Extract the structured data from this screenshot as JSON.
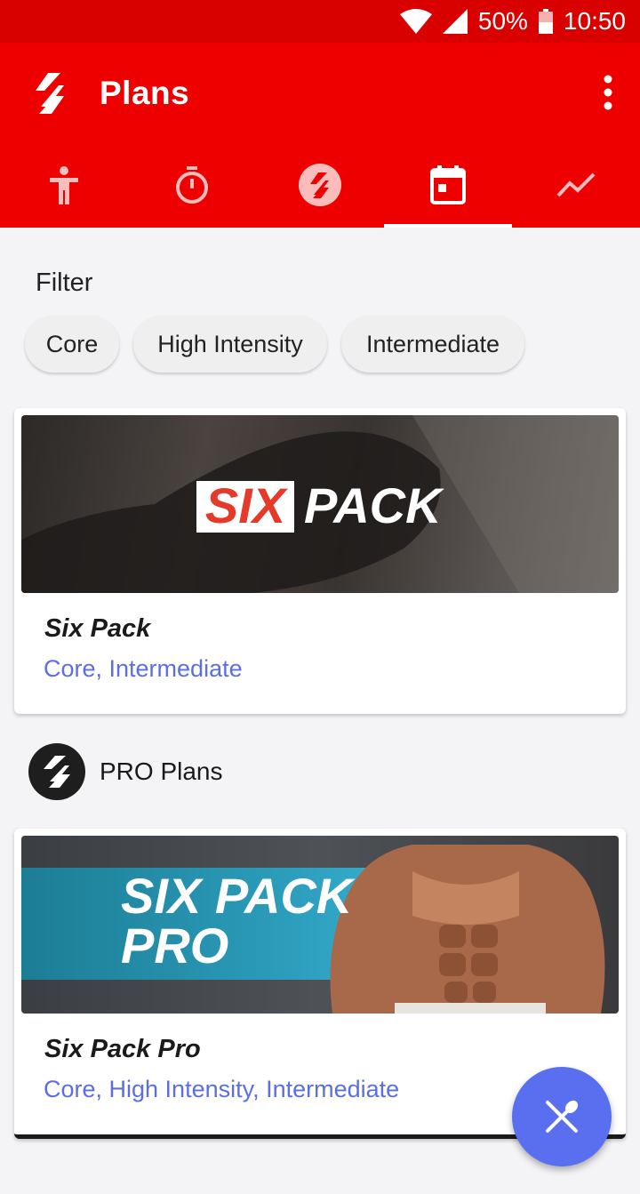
{
  "status_bar": {
    "battery": "50%",
    "time": "10:50"
  },
  "app_bar": {
    "title": "Plans",
    "more_icon": "more-vert-icon"
  },
  "tabs": [
    {
      "icon": "person-icon",
      "selected": false
    },
    {
      "icon": "stopwatch-icon",
      "selected": false
    },
    {
      "icon": "freeletics-logo-icon",
      "selected": false
    },
    {
      "icon": "calendar-icon",
      "selected": true
    },
    {
      "icon": "trend-chart-icon",
      "selected": false
    }
  ],
  "filter": {
    "title": "Filter",
    "chips": [
      "Core",
      "High Intensity",
      "Intermediate"
    ]
  },
  "plans": [
    {
      "banner": {
        "word1": "SIX",
        "word2": "PACK"
      },
      "name": "Six Pack",
      "tags": "Core, Intermediate"
    }
  ],
  "pro_section": {
    "title": "PRO Plans"
  },
  "pro_plans": [
    {
      "banner": {
        "line1": "SIX PACK",
        "line2": "PRO"
      },
      "name": "Six Pack Pro",
      "tags": "Core, High Intensity, Intermediate"
    }
  ],
  "fab": {
    "icon": "fork-knife-icon"
  },
  "colors": {
    "primary": "#ee0000",
    "status_bar": "#d90000",
    "accent": "#5a6ff0",
    "tag_text": "#5b6ee6"
  }
}
